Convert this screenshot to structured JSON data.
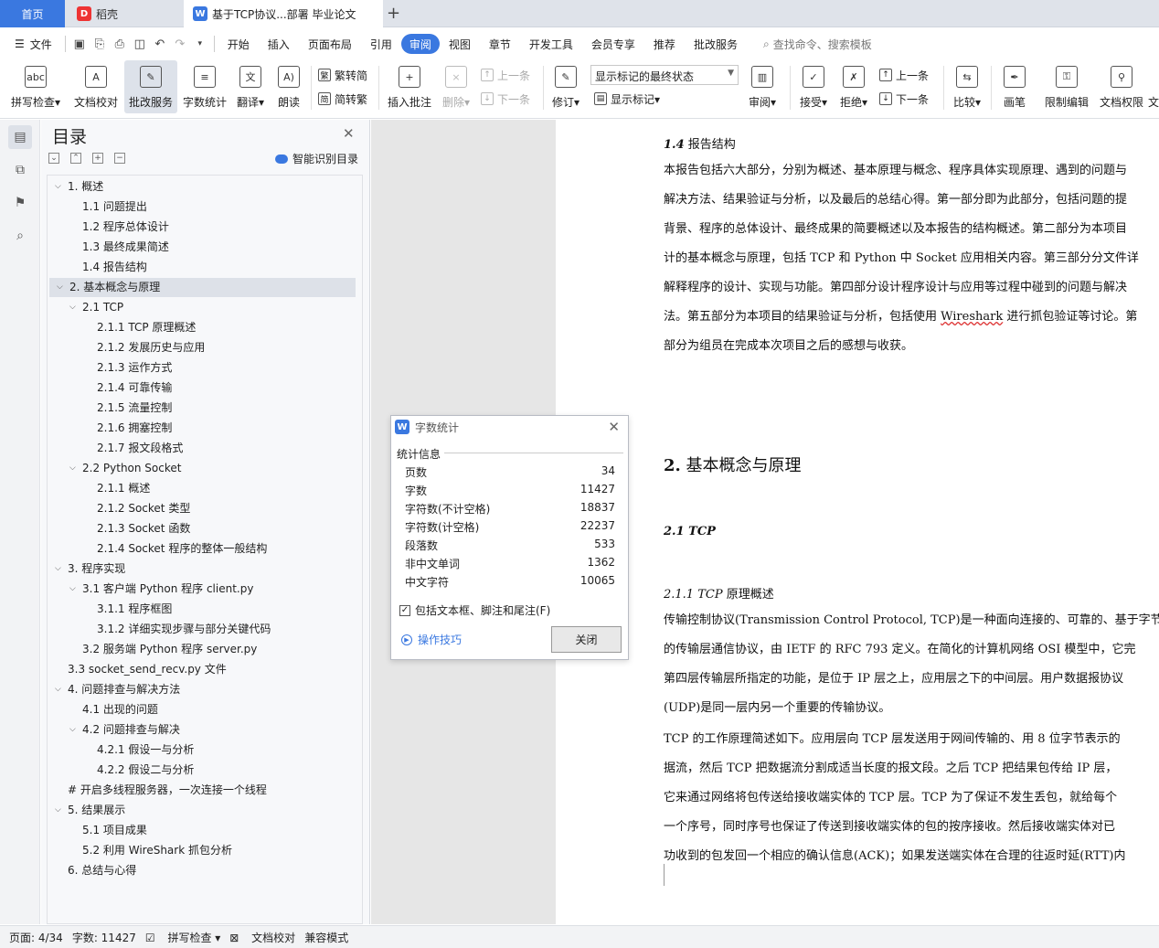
{
  "tabs": {
    "home": "首页",
    "daoke": "稻壳",
    "document": "基于TCP协议...部署 毕业论文"
  },
  "menu": {
    "file": "文件",
    "items": [
      "开始",
      "插入",
      "页面布局",
      "引用",
      "审阅",
      "视图",
      "章节",
      "开发工具",
      "会员专享",
      "推荐",
      "批改服务"
    ],
    "active": "审阅",
    "search": "查找命令、搜索模板"
  },
  "ribbon": {
    "spell_check": "拼写检查",
    "doc_proofread": "文档校对",
    "review_service": "批改服务",
    "word_count": "字数统计",
    "translate": "翻译",
    "read_aloud": "朗读",
    "trad_to_simp": "繁转简",
    "simp_to_trad": "简转繁",
    "insert_comment": "插入批注",
    "delete": "删除",
    "prev_comment": "上一条",
    "next_comment": "下一条",
    "track_changes": "修订",
    "markup_select": "显示标记的最终状态",
    "show_markup": "显示标记",
    "review": "审阅",
    "accept": "接受",
    "reject": "拒绝",
    "prev_change": "上一条",
    "next_change": "下一条",
    "compare": "比较",
    "pen": "画笔",
    "restrict_edit": "限制编辑",
    "doc_permission": "文档权限",
    "doc_more": "文"
  },
  "toc": {
    "title": "目录",
    "smart": "智能识别目录",
    "items": [
      {
        "label": "1. 概述",
        "level": 1,
        "tw": "v"
      },
      {
        "label": "1.1 问题提出",
        "level": 2,
        "tw": ""
      },
      {
        "label": "1.2 程序总体设计",
        "level": 2,
        "tw": ""
      },
      {
        "label": "1.3 最终成果简述",
        "level": 2,
        "tw": ""
      },
      {
        "label": "1.4 报告结构",
        "level": 2,
        "tw": ""
      },
      {
        "label": "2. 基本概念与原理",
        "level": 1,
        "tw": "v",
        "sel": true
      },
      {
        "label": "2.1 TCP",
        "level": 2,
        "tw": "v"
      },
      {
        "label": "2.1.1 TCP 原理概述",
        "level": 3,
        "tw": ""
      },
      {
        "label": "2.1.2 发展历史与应用",
        "level": 3,
        "tw": ""
      },
      {
        "label": "2.1.3 运作方式",
        "level": 3,
        "tw": ""
      },
      {
        "label": "2.1.4 可靠传输",
        "level": 3,
        "tw": ""
      },
      {
        "label": "2.1.5 流量控制",
        "level": 3,
        "tw": ""
      },
      {
        "label": "2.1.6 拥塞控制",
        "level": 3,
        "tw": ""
      },
      {
        "label": "2.1.7 报文段格式",
        "level": 3,
        "tw": ""
      },
      {
        "label": "2.2 Python Socket",
        "level": 2,
        "tw": "v"
      },
      {
        "label": "2.1.1 概述",
        "level": 3,
        "tw": ""
      },
      {
        "label": "2.1.2 Socket 类型",
        "level": 3,
        "tw": ""
      },
      {
        "label": "2.1.3 Socket 函数",
        "level": 3,
        "tw": ""
      },
      {
        "label": "2.1.4 Socket 程序的整体一般结构",
        "level": 3,
        "tw": ""
      },
      {
        "label": "3. 程序实现",
        "level": 1,
        "tw": "v"
      },
      {
        "label": "3.1 客户端 Python 程序 client.py",
        "level": 2,
        "tw": "v"
      },
      {
        "label": "3.1.1 程序框图",
        "level": 3,
        "tw": ""
      },
      {
        "label": "3.1.2 详细实现步骤与部分关键代码",
        "level": 3,
        "tw": ""
      },
      {
        "label": "3.2 服务端 Python 程序 server.py",
        "level": 2,
        "tw": ""
      },
      {
        "label": "3.3 socket_send_recv.py 文件",
        "level": 1,
        "tw": ""
      },
      {
        "label": "4. 问题排查与解决方法",
        "level": 1,
        "tw": "v"
      },
      {
        "label": "4.1 出现的问题",
        "level": 2,
        "tw": ""
      },
      {
        "label": "4.2 问题排查与解决",
        "level": 2,
        "tw": "v"
      },
      {
        "label": "4.2.1 假设一与分析",
        "level": 3,
        "tw": ""
      },
      {
        "label": "4.2.2 假设二与分析",
        "level": 3,
        "tw": ""
      },
      {
        "label": "# 开启多线程服务器，一次连接一个线程",
        "level": 1,
        "tw": ""
      },
      {
        "label": "5. 结果展示",
        "level": 1,
        "tw": "v"
      },
      {
        "label": "5.1 项目成果",
        "level": 2,
        "tw": ""
      },
      {
        "label": "5.2 利用 WireShark 抓包分析",
        "level": 2,
        "tw": ""
      },
      {
        "label": "6. 总结与心得",
        "level": 1,
        "tw": ""
      }
    ]
  },
  "doc": {
    "h14_num": "1.4",
    "h14_text": " 报告结构",
    "p1": [
      " 本报告包括六大部分，分别为概述、基本原理与概念、程序具体实现原理、遇到的问题与",
      "解决方法、结果验证与分析，以及最后的总结心得。第一部分即为此部分，包括问题的提",
      "背景、程序的总体设计、最终成果的简要概述以及本报告的结构概述。第二部分为本项目",
      "计的基本概念与原理，包括 TCP 和 Python 中 Socket 应用相关内容。第三部分分文件详",
      "解释程序的设计、实现与功能。第四部分设计程序设计与应用等过程中碰到的问题与解决",
      "法。第五部分为本项目的结果验证与分析，包括使用 ",
      "部分为组员在完成本次项目之后的感想与收获。"
    ],
    "wireshark": "Wireshark",
    "p1_tail": " 进行抓包验证等讨论。第",
    "h2_num": "2.",
    "h2_text": " 基本概念与原理",
    "h21": "2.1 TCP",
    "h211_num": "2.1.1",
    "h211_tcp": " TCP",
    "h211_text": " 原理概述",
    "p2": [
      " 传输控制协议(Transmission Control Protocol, TCP)是一种面向连接的、可靠的、基于字节",
      "的传输层通信协议，由 IETF 的 RFC 793 定义。在简化的计算机网络 OSI 模型中，它完",
      "第四层传输层所指定的功能，是位于 IP 层之上，应用层之下的中间层。用户数据报协议",
      "(UDP)是同一层内另一个重要的传输协议。"
    ],
    "p3": [
      " TCP 的工作原理简述如下。应用层向 TCP 层发送用于网间传输的、用 8 位字节表示的",
      "据流，然后 TCP 把数据流分割成适当长度的报文段。之后 TCP 把结果包传给 IP 层，",
      "它来通过网络将包传送给接收端实体的 TCP 层。TCP 为了保证不发生丢包，就给每个",
      "一个序号，同时序号也保证了传送到接收端实体的包的按序接收。然后接收端实体对已",
      "功收到的包发回一个相应的确认信息(ACK)；如果发送端实体在合理的往返时延(RTT)内"
    ]
  },
  "dialog": {
    "title": "字数统计",
    "section": "统计信息",
    "rows": [
      {
        "k": "页数",
        "v": "34"
      },
      {
        "k": "字数",
        "v": "11427"
      },
      {
        "k": "字符数(不计空格)",
        "v": "18837"
      },
      {
        "k": "字符数(计空格)",
        "v": "22237"
      },
      {
        "k": "段落数",
        "v": "533"
      },
      {
        "k": "非中文单词",
        "v": "1362"
      },
      {
        "k": "中文字符",
        "v": "10065"
      }
    ],
    "include": "包括文本框、脚注和尾注(F)",
    "tips": "操作技巧",
    "close": "关闭"
  },
  "status": {
    "page": "页面: 4/34",
    "words": "字数: 11427",
    "spell": "拼写检查",
    "proof": "文档校对",
    "compat": "兼容模式"
  },
  "colors": {
    "accent": "#3a78e0"
  }
}
